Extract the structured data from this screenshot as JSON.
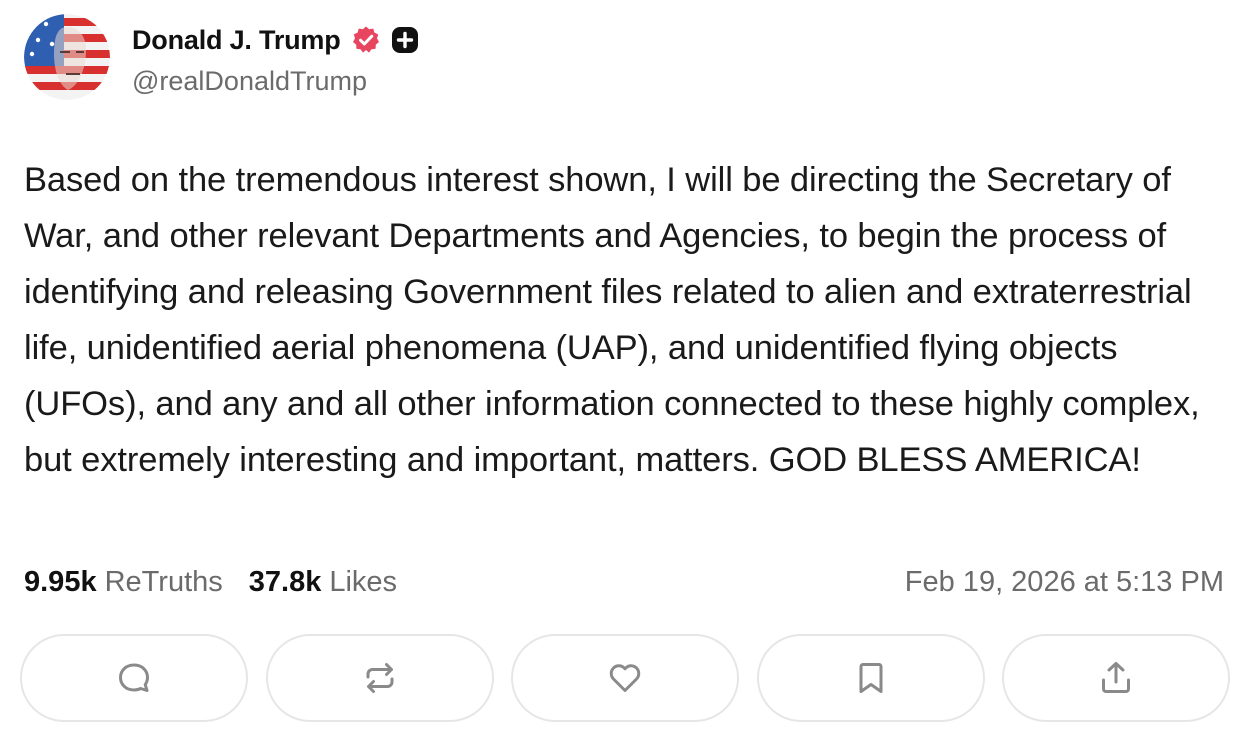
{
  "author": {
    "display_name": "Donald J. Trump",
    "handle": "@realDonaldTrump",
    "verified_icon": "verified-badge-icon",
    "plus_icon": "plus-badge-icon",
    "verified_color": "#e8455f"
  },
  "post": {
    "text": "Based on the tremendous interest shown, I will be directing the Secretary of War, and other relevant Departments and Agencies, to begin the process of identifying and releasing Government files related to alien and extraterrestrial life, unidentified aerial phenomena (UAP), and unidentified flying objects (UFOs), and any and all other information connected to these highly complex, but extremely interesting and important, matters. GOD BLESS AMERICA!"
  },
  "stats": {
    "retruths_count": "9.95k",
    "retruths_label": "ReTruths",
    "likes_count": "37.8k",
    "likes_label": "Likes",
    "timestamp": "Feb 19, 2026 at 5:13 PM"
  },
  "actions": [
    {
      "icon": "reply-icon"
    },
    {
      "icon": "retruth-icon"
    },
    {
      "icon": "like-icon"
    },
    {
      "icon": "bookmark-icon"
    },
    {
      "icon": "share-icon"
    }
  ],
  "colors": {
    "text": "#1a1a1a",
    "muted": "#6b6b6b",
    "border": "#e6e6e6",
    "icon": "#8a8a8a"
  }
}
